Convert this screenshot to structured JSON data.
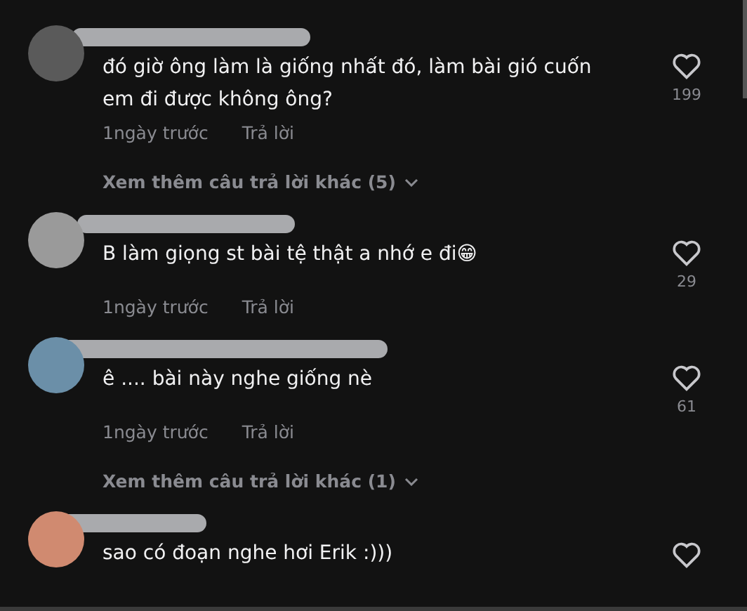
{
  "comments": [
    {
      "text": "đó giờ ông làm là giống nhất đó, làm bài gió cuốn em đi được không ông?",
      "likes": "199",
      "time": "1ngày trước",
      "reply": "Trả lời",
      "more_replies": "Xem thêm câu trả lời khác (5)"
    },
    {
      "text": "B làm giọng st bài tệ thật a nhớ e đi😁",
      "likes": "29",
      "time": "1ngày trước",
      "reply": "Trả lời"
    },
    {
      "text": "ê .... bài này nghe giống nè",
      "likes": "61",
      "time": "1ngày trước",
      "reply": "Trả lời",
      "more_replies": "Xem thêm câu trả lời khác (1)"
    },
    {
      "text": "sao có đoạn nghe hơi Erik :)))"
    }
  ]
}
